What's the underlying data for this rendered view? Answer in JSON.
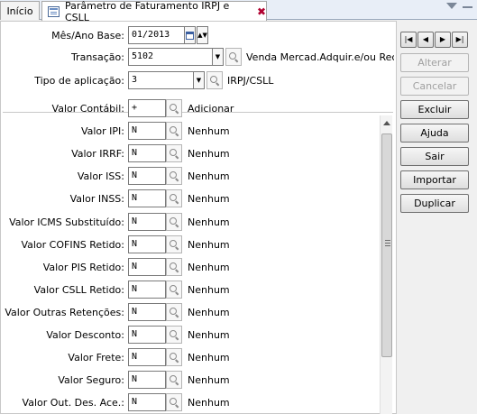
{
  "tabs": {
    "home_label": "Início",
    "active_label": "Parâmetro de Faturamento IRPJ e CSLL"
  },
  "header": {
    "mes_ano_label": "Mês/Ano Base:",
    "mes_ano_value": "01/2013",
    "transacao_label": "Transação:",
    "transacao_value": "5102",
    "transacao_desc": "Venda Mercad.Adquir.e/ou Rec",
    "tipo_label": "Tipo de aplicação:",
    "tipo_value": "3",
    "tipo_desc": "IRPJ/CSLL"
  },
  "fields": [
    {
      "label": "Valor Contábil:",
      "value": "+",
      "desc": "Adicionar"
    },
    {
      "label": "Valor IPI:",
      "value": "N",
      "desc": "Nenhum"
    },
    {
      "label": "Valor IRRF:",
      "value": "N",
      "desc": "Nenhum"
    },
    {
      "label": "Valor ISS:",
      "value": "N",
      "desc": "Nenhum"
    },
    {
      "label": "Valor INSS:",
      "value": "N",
      "desc": "Nenhum"
    },
    {
      "label": "Valor ICMS Substituído:",
      "value": "N",
      "desc": "Nenhum"
    },
    {
      "label": "Valor COFINS Retido:",
      "value": "N",
      "desc": "Nenhum"
    },
    {
      "label": "Valor PIS Retido:",
      "value": "N",
      "desc": "Nenhum"
    },
    {
      "label": "Valor CSLL Retido:",
      "value": "N",
      "desc": "Nenhum"
    },
    {
      "label": "Valor Outras Retenções:",
      "value": "N",
      "desc": "Nenhum"
    },
    {
      "label": "Valor Desconto:",
      "value": "N",
      "desc": "Nenhum"
    },
    {
      "label": "Valor Frete:",
      "value": "N",
      "desc": "Nenhum"
    },
    {
      "label": "Valor Seguro:",
      "value": "N",
      "desc": "Nenhum"
    },
    {
      "label": "Valor Out. Des. Ace.:",
      "value": "N",
      "desc": "Nenhum"
    }
  ],
  "nav_buttons": [
    "first",
    "previous",
    "next",
    "last"
  ],
  "actions": [
    {
      "name": "alterar-button",
      "label": "Alterar",
      "enabled": false
    },
    {
      "name": "cancelar-button",
      "label": "Cancelar",
      "enabled": false
    },
    {
      "name": "excluir-button",
      "label": "Excluir",
      "enabled": true
    },
    {
      "name": "ajuda-button",
      "label": "Ajuda",
      "enabled": true
    },
    {
      "name": "sair-button",
      "label": "Sair",
      "enabled": true
    },
    {
      "name": "importar-button",
      "label": "Importar",
      "enabled": true
    },
    {
      "name": "duplicar-button",
      "label": "Duplicar",
      "enabled": true
    }
  ],
  "icons": {
    "tab": "form-window-icon",
    "close": "close-x-icon",
    "lookup": "magnifier-icon",
    "calendar": "calendar-icon",
    "dropdown": "chevron-down-icon"
  }
}
